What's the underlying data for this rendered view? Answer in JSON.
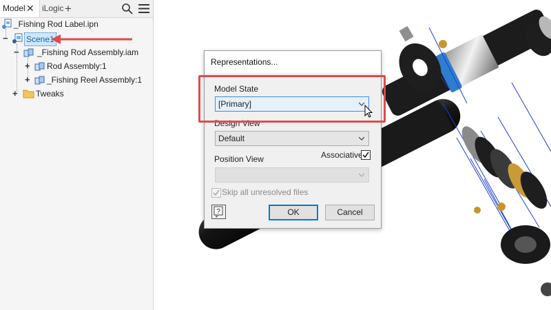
{
  "browser": {
    "tabs": [
      {
        "label": "Model"
      },
      {
        "label": "iLogic"
      }
    ],
    "tree": {
      "root_label": "_Fishing Rod Label.ipn",
      "scene_label": "Scene1",
      "assembly_label": "_Fishing Rod Assembly.iam",
      "children": [
        {
          "label": "Rod Assembly:1"
        },
        {
          "label": "_Fishing Reel Assembly:1"
        }
      ],
      "tweaks_label": "Tweaks"
    }
  },
  "dialog": {
    "title": "Representations...",
    "model_state": {
      "label": "Model State",
      "value": "[Primary]"
    },
    "design_view": {
      "label": "Design View",
      "value": "Default"
    },
    "associative": {
      "label": "Associative",
      "checked": true
    },
    "position_view": {
      "label": "Position View",
      "value": ""
    },
    "skip_unresolved": {
      "label": "Skip all unresolved files",
      "checked": true
    },
    "ok_label": "OK",
    "cancel_label": "Cancel"
  },
  "colors": {
    "annotation": "#e04b4b",
    "selection": "#cce8ff",
    "accent": "#0078d7"
  }
}
